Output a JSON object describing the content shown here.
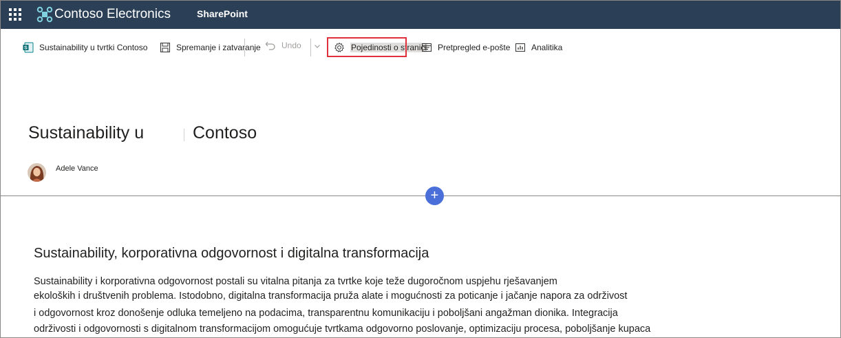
{
  "suitebar": {
    "brand": "Contoso Electronics",
    "app": "SharePoint",
    "background": "#2b4057"
  },
  "commandbar": {
    "site_label": "Sustainability u tvrtki Contoso",
    "save_close_label": "Spremanje i zatvaranje",
    "undo_label": "Undo",
    "page_details_label": "Pojedinosti o stranici",
    "email_preview_label": "Pretpregled e-pošte",
    "analytics_label": "Analitika",
    "icons": [
      "sharepoint-site-icon",
      "save-icon",
      "undo-icon",
      "chevron-down-icon",
      "gear-icon",
      "email-preview-icon",
      "analytics-icon"
    ]
  },
  "page": {
    "title_start": "Sustainability u",
    "title_end": "Contoso",
    "author": "Adele Vance"
  },
  "content": {
    "heading": "Sustainability, korporativna odgovornost i digitalna transformacija",
    "lines": [
      "Sustainability i korporativna odgovornost postali su vitalna pitanja za tvrtke koje teže dugoročnom uspjehu rješavanjem",
      "ekoloških i društvenih problema. Istodobno, digitalna transformacija pruža alate i mogućnosti za poticanje i jačanje napora za održivost",
      "i odgovornost kroz donošenje odluka temeljeno na podacima, transparentnu komunikaciju i poboljšani angažman dionika. Integracija",
      "održivosti i odgovornosti s digitalnom transformacijom omogućuje tvrtkama odgovorno poslovanje, optimizaciju procesa, poboljšanje kupaca"
    ]
  },
  "colors": {
    "accent": "#4a6fd8",
    "highlight_border": "#e0313b"
  }
}
